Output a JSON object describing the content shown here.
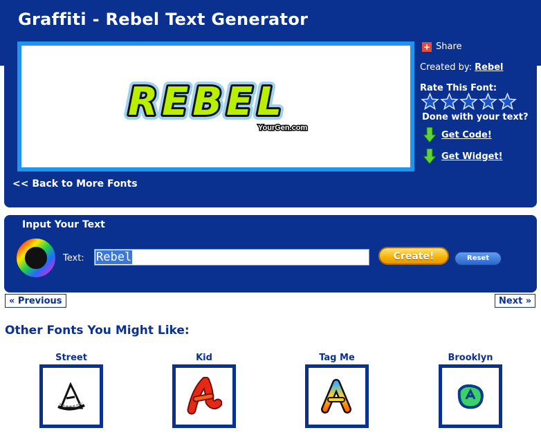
{
  "page": {
    "title": "Graffiti - Rebel Text Generator"
  },
  "preview": {
    "text": "REBEL",
    "watermark": "YourGen.com"
  },
  "sidebar": {
    "share": "Share",
    "created_by_label": "Created by:",
    "created_by_name": "Rebel",
    "rate_label": "Rate This Font:",
    "stars": 5,
    "done_label": "Done with your text?",
    "get_code": "Get Code!",
    "get_widget": "Get Widget!"
  },
  "back_link": "<< Back to More Fonts",
  "input_panel": {
    "title": "Input Your Text",
    "text_label": "Text:",
    "text_value": "Rebel",
    "create": "Create!",
    "reset": "Reset"
  },
  "nav": {
    "previous": "« Previous",
    "next": "Next »"
  },
  "other_fonts": {
    "heading": "Other Fonts You Might Like:",
    "items": [
      {
        "name": "Street"
      },
      {
        "name": "Kid"
      },
      {
        "name": "Tag Me"
      },
      {
        "name": "Brooklyn"
      }
    ]
  },
  "colors": {
    "panel": "#0a3190",
    "preview_border": "#1e96ef",
    "letter_fill": "#b9f000",
    "create_button": "#f7b70b"
  }
}
